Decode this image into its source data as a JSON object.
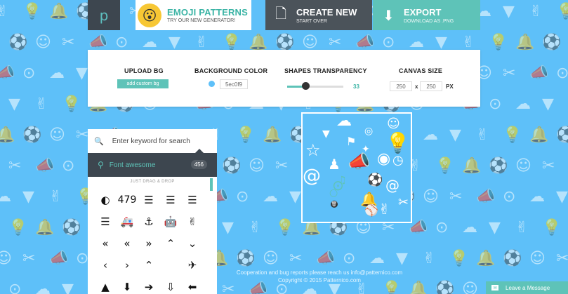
{
  "colors": {
    "background": "#5ec0f9",
    "accent": "#5ec3b8",
    "dark": "#3d464f"
  },
  "header": {
    "logo": "p",
    "emoji_face": "😮",
    "emoji_title": "EMOJI PATTERNS",
    "emoji_subtitle": "TRY OUR NEW GENERATOR!",
    "create_icon": "document-icon",
    "create_title": "CREATE NEW",
    "create_subtitle": "START OVER",
    "export_icon": "download-icon",
    "export_title": "EXPORT",
    "export_subtitle": "DOWNLOAD AS .PNG"
  },
  "controls": {
    "upload_label": "UPLOAD BG",
    "upload_button": "add custom bg",
    "bg_color_label": "BACKGROUND COLOR",
    "bg_color_value": "5ec0f9",
    "transparency_label": "SHAPES TRANSPARENCY",
    "transparency_value": "33",
    "transparency_fraction": 0.33,
    "canvas_size_label": "CANVAS SIZE",
    "width_value": "250",
    "height_value": "250",
    "size_separator": "x",
    "size_unit": "PX"
  },
  "library": {
    "search_placeholder": "Enter keyword for search",
    "library_name": "Font awesome",
    "library_count": "456",
    "drag_hint": "JUST DRAG & DROP",
    "icons": [
      {
        "glyph": "◐",
        "name": "adjust-icon"
      },
      {
        "glyph": "479",
        "name": "number-icon"
      },
      {
        "glyph": "☰",
        "name": "align-center-icon"
      },
      {
        "glyph": "☰",
        "name": "align-justify-icon"
      },
      {
        "glyph": "☰",
        "name": "align-left-icon"
      },
      {
        "glyph": "☰",
        "name": "align-right-icon"
      },
      {
        "glyph": "🚑",
        "name": "ambulance-icon"
      },
      {
        "glyph": "⚓",
        "name": "anchor-icon"
      },
      {
        "glyph": "🤖",
        "name": "android-icon"
      },
      {
        "glyph": "✌",
        "name": "peace-icon"
      },
      {
        "glyph": "«",
        "name": "angle-double-down-icon"
      },
      {
        "glyph": "«",
        "name": "angle-double-left-icon"
      },
      {
        "glyph": "»",
        "name": "angle-double-right-icon"
      },
      {
        "glyph": "⌃",
        "name": "angle-double-up-icon"
      },
      {
        "glyph": "⌄",
        "name": "angle-down-icon"
      },
      {
        "glyph": "‹",
        "name": "angle-left-icon"
      },
      {
        "glyph": "›",
        "name": "angle-right-icon"
      },
      {
        "glyph": "⌃",
        "name": "angle-up-icon"
      },
      {
        "glyph": "",
        "name": "apple-icon"
      },
      {
        "glyph": "✈",
        "name": "plane-icon"
      },
      {
        "glyph": "▲",
        "name": "area-chart-icon"
      },
      {
        "glyph": "⬇",
        "name": "arrow-circle-down-icon"
      },
      {
        "glyph": "➔",
        "name": "arrow-circle-right-icon"
      },
      {
        "glyph": "⇩",
        "name": "arrow-circle-o-down-icon"
      },
      {
        "glyph": "⬅",
        "name": "arrow-circle-left-icon"
      }
    ]
  },
  "canvas": {
    "delete_glyph": "🗑",
    "shapes": [
      "☁",
      "◎",
      "☺",
      "▼",
      "⚑",
      "☆",
      "💡",
      "✦",
      "@",
      "♟",
      "📣",
      "◉",
      "◷",
      "⊙",
      "♫",
      "⚽",
      "@",
      "🔔",
      "✌",
      "⚾",
      "✂",
      "○"
    ]
  },
  "footer": {
    "line1": "Cooperation and bug reports please reach us info@patternico.com",
    "line2": "Copyright © 2015 Patternico.com"
  },
  "message_button": {
    "label": "Leave a Message"
  },
  "background_icons": [
    "✌",
    "💡",
    "🔔",
    "⚽",
    "☺",
    "✂",
    "📣",
    "⊙",
    "☁",
    "▼"
  ]
}
